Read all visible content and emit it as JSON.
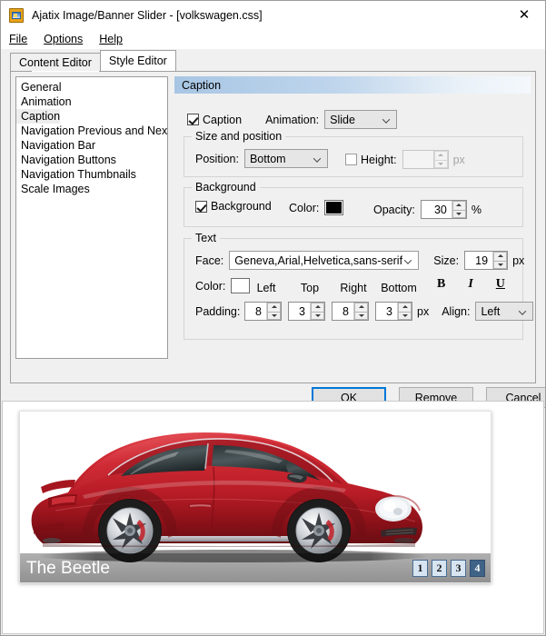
{
  "window": {
    "title": "Ajatix Image/Banner Slider - [volkswagen.css]",
    "icon": "app-icon",
    "close_label": "✕"
  },
  "menubar": {
    "items": [
      {
        "label": "File",
        "accel": "F"
      },
      {
        "label": "Options",
        "accel": "O"
      },
      {
        "label": "Help",
        "accel": "H"
      }
    ]
  },
  "tabs": [
    {
      "label": "Content Editor",
      "active": false
    },
    {
      "label": "Style Editor",
      "active": true
    }
  ],
  "style_list": {
    "items": [
      {
        "label": "General",
        "selected": false
      },
      {
        "label": "Animation",
        "selected": false
      },
      {
        "label": "Caption",
        "selected": true
      },
      {
        "label": "Navigation Previous and Next",
        "selected": false
      },
      {
        "label": "Navigation Bar",
        "selected": false
      },
      {
        "label": "Navigation Buttons",
        "selected": false
      },
      {
        "label": "Navigation Thumbnails",
        "selected": false
      },
      {
        "label": "Scale Images",
        "selected": false
      }
    ]
  },
  "panel": {
    "header": "Caption",
    "caption_checkbox": {
      "label": "Caption",
      "checked": true
    },
    "animation": {
      "label": "Animation:",
      "value": "Slide"
    },
    "size_and_position": {
      "title": "Size and position",
      "position_label": "Position:",
      "position_value": "Bottom",
      "height_label": "Height:",
      "height_checked": false,
      "height_value": "",
      "height_unit": "px"
    },
    "background": {
      "title": "Background",
      "checkbox_label": "Background",
      "checked": true,
      "color_label": "Color:",
      "color_value": "#000000",
      "opacity_label": "Opacity:",
      "opacity_value": "30",
      "opacity_unit": "%"
    },
    "text": {
      "title": "Text",
      "face_label": "Face:",
      "face_value": "Geneva,Arial,Helvetica,sans-serif",
      "size_label": "Size:",
      "size_value": "19",
      "size_unit": "px",
      "color_label": "Color:",
      "color_value": "#ffffff",
      "bold_label": "B",
      "italic_label": "I",
      "underline_label": "U",
      "padding_label": "Padding:",
      "padding_unit": "px",
      "padding_headers": [
        "Left",
        "Top",
        "Right",
        "Bottom"
      ],
      "padding_left": "8",
      "padding_top": "3",
      "padding_right": "8",
      "padding_bottom": "3",
      "align_label": "Align:",
      "align_value": "Left"
    }
  },
  "dialog_buttons": {
    "ok": "OK",
    "remove": "Remove",
    "cancel": "Cancel"
  },
  "preview": {
    "caption": "The Beetle",
    "nav": [
      {
        "label": "1",
        "active": false
      },
      {
        "label": "2",
        "active": false
      },
      {
        "label": "3",
        "active": false
      },
      {
        "label": "4",
        "active": true
      }
    ],
    "image_alt": "red-volkswagen-beetle-side-view",
    "colors": {
      "caption_overlay": "rgba(0,0,0,0.30)",
      "nav_active": "#3f6287",
      "nav_inactive": "#d7e5f2",
      "car_body": "#c2202c"
    }
  }
}
